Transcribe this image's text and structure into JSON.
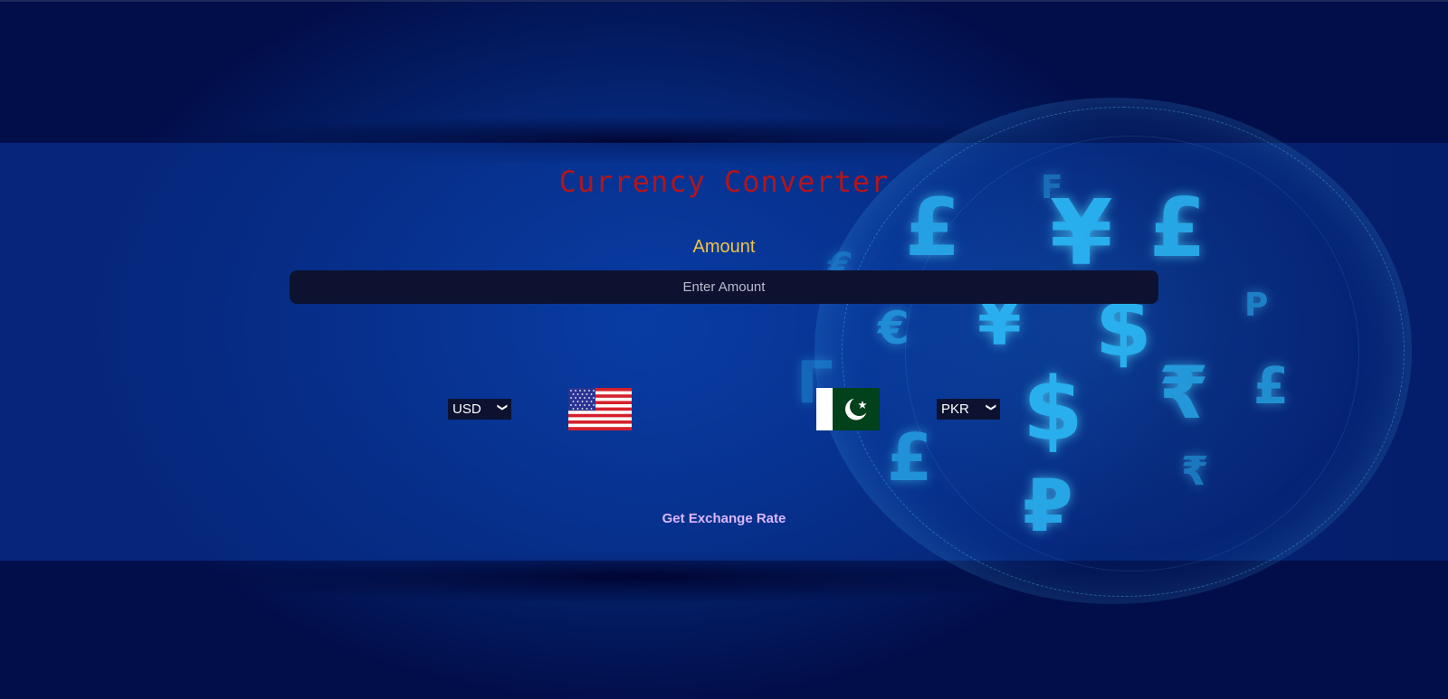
{
  "header": {
    "title": "Currency Converter"
  },
  "amount": {
    "label": "Amount",
    "placeholder": "Enter Amount",
    "value": ""
  },
  "from_currency": {
    "selected": "USD",
    "flag": "us-flag-icon"
  },
  "to_currency": {
    "selected": "PKR",
    "flag": "pk-flag-icon"
  },
  "actions": {
    "exchange_label": "Get Exchange Rate"
  },
  "colors": {
    "title": "#b3151c",
    "amount_label": "#f0c443",
    "button_text": "#d9b8ff",
    "input_background": "#0c1230"
  },
  "background_symbols": [
    "£",
    "¥",
    "£",
    "€",
    "¥",
    "$",
    "P",
    "₹",
    "£",
    "$",
    "£",
    "₽",
    "₹",
    "€",
    "F",
    "Г",
    "£"
  ]
}
